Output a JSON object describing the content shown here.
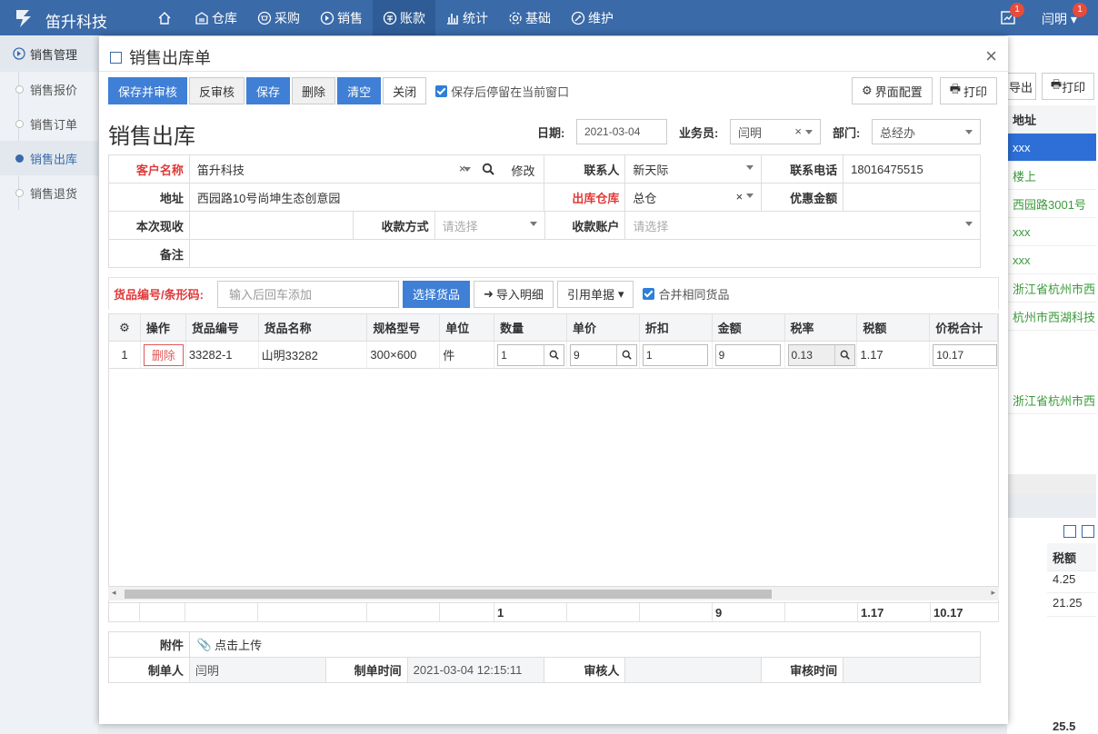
{
  "app": {
    "brand": "笛升科技"
  },
  "nav": [
    {
      "label": "",
      "icon": "home-icon"
    },
    {
      "label": "仓库",
      "icon": "warehouse-icon"
    },
    {
      "label": "采购",
      "icon": "cart-icon"
    },
    {
      "label": "销售",
      "icon": "tag-icon"
    },
    {
      "label": "账款",
      "icon": "money-icon"
    },
    {
      "label": "统计",
      "icon": "chart-icon"
    },
    {
      "label": "基础",
      "icon": "gear-icon"
    },
    {
      "label": "维护",
      "icon": "maintain-icon"
    }
  ],
  "top_right": {
    "notify_count": "1",
    "user_name": "闫明",
    "user_badge": "1"
  },
  "sidebar": {
    "title": "销售管理",
    "items": [
      {
        "label": "销售报价"
      },
      {
        "label": "销售订单"
      },
      {
        "label": "销售出库"
      },
      {
        "label": "销售退货"
      }
    ]
  },
  "background": {
    "export_label": "导出",
    "print_label": "打印",
    "address_header": "地址",
    "addresses": [
      "xxx",
      "楼上",
      "西园路3001号",
      "xxx",
      "xxx",
      "浙江省杭州市西",
      "杭州市西湖科技",
      "浙江省杭州市西"
    ],
    "tax_header": "税额",
    "tax_values": [
      "4.25",
      "21.25"
    ],
    "tax_total": "25.5"
  },
  "modal": {
    "title": "销售出库单",
    "toolbar": {
      "save_audit": "保存并审核",
      "unaudit": "反审核",
      "save": "保存",
      "delete": "删除",
      "clear": "清空",
      "close": "关闭",
      "stay_label": "保存后停留在当前窗口",
      "ui_config": "界面配置",
      "print": "打印"
    },
    "form_title": "销售出库",
    "date_label": "日期:",
    "date_value": "2021-03-04",
    "salesman_label": "业务员:",
    "salesman_value": "闫明",
    "dept_label": "部门:",
    "dept_value": "总经办",
    "fields": {
      "customer_label": "客户名称",
      "customer_value": "笛升科技",
      "edit_label": "修改",
      "contact_label": "联系人",
      "contact_value": "新天际",
      "phone_label": "联系电话",
      "phone_value": "18016475515",
      "address_label": "地址",
      "address_value": "西园路10号尚坤生态创意园",
      "warehouse_label": "出库仓库",
      "warehouse_value": "总仓",
      "discount_label": "优惠金额",
      "discount_value": "",
      "received_label": "本次现收",
      "received_value": "",
      "pay_method_label": "收款方式",
      "pay_method_placeholder": "请选择",
      "account_label": "收款账户",
      "account_placeholder": "请选择",
      "remark_label": "备注",
      "remark_value": ""
    },
    "goods": {
      "label": "货品编号/条形码:",
      "placeholder": "输入后回车添加",
      "select_btn": "选择货品",
      "import_btn": "导入明细",
      "ref_btn": "引用单据",
      "merge_label": "合并相同货品"
    },
    "table": {
      "headers": [
        "操作",
        "货品编号",
        "货品名称",
        "规格型号",
        "单位",
        "数量",
        "单价",
        "折扣",
        "金额",
        "税率",
        "税额",
        "价税合计"
      ],
      "rows": [
        {
          "index": "1",
          "action": "删除",
          "code": "33282-1",
          "name": "山明33282",
          "spec": "300×600",
          "unit": "件",
          "qty": "1",
          "price": "9",
          "discount": "1",
          "amount": "9",
          "tax_rate": "0.13",
          "tax": "1.17",
          "total": "10.17"
        }
      ],
      "footer": {
        "qty": "1",
        "amount": "9",
        "tax": "1.17",
        "total": "10.17"
      }
    },
    "attachment": {
      "label": "附件",
      "upload": "点击上传"
    },
    "meta": {
      "creator_label": "制单人",
      "creator_value": "闫明",
      "created_label": "制单时间",
      "created_value": "2021-03-04 12:15:11",
      "auditor_label": "审核人",
      "auditor_value": "",
      "audit_time_label": "审核时间",
      "audit_time_value": ""
    }
  }
}
